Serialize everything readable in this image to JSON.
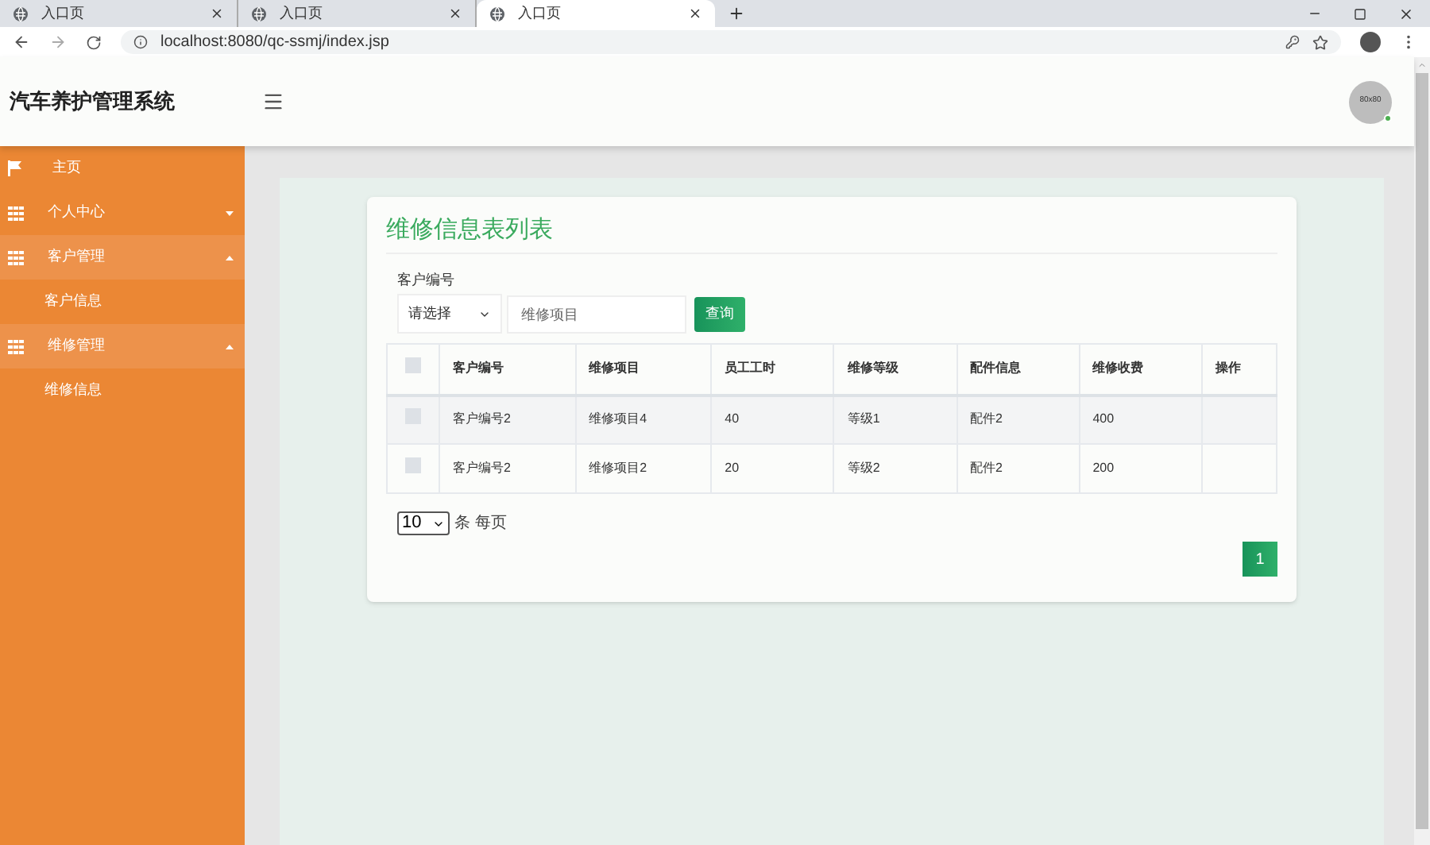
{
  "browser": {
    "tabs": [
      {
        "title": "入口页",
        "selected": false
      },
      {
        "title": "入口页",
        "selected": false
      },
      {
        "title": "入口页",
        "selected": true
      }
    ],
    "address": "localhost:8080/qc-ssmj/index.jsp"
  },
  "header": {
    "title": "汽车养护管理系统",
    "avatar": "80x80"
  },
  "sidebar": {
    "items": [
      {
        "label": "主页",
        "kind": "link"
      },
      {
        "label": "个人中心",
        "kind": "group",
        "expanded": false
      },
      {
        "label": "客户管理",
        "kind": "group",
        "expanded": true,
        "children": [
          {
            "label": "客户信息"
          }
        ]
      },
      {
        "label": "维修管理",
        "kind": "group",
        "expanded": true,
        "children": [
          {
            "label": "维修信息"
          }
        ]
      }
    ]
  },
  "card": {
    "title": "维修信息表列表",
    "filter_label": "客户编号",
    "select_value": "请选择",
    "search_placeholder": "维修项目",
    "search_button": "查询"
  },
  "table": {
    "columns": [
      "客户编号",
      "维修项目",
      "员工工时",
      "维修等级",
      "配件信息",
      "维修收费",
      "操作"
    ],
    "header_checked": false,
    "rows": [
      {
        "checked": false,
        "cells": [
          "客户编号2",
          "维修项目4",
          "40",
          "等级1",
          "配件2",
          "400",
          ""
        ]
      },
      {
        "checked": false,
        "cells": [
          "客户编号2",
          "维修项目2",
          "20",
          "等级2",
          "配件2",
          "200",
          ""
        ]
      }
    ]
  },
  "pagination": {
    "page_size": "10",
    "page_size_label": "条 每页",
    "pages": [
      {
        "label": "1",
        "selected": true
      }
    ]
  }
}
